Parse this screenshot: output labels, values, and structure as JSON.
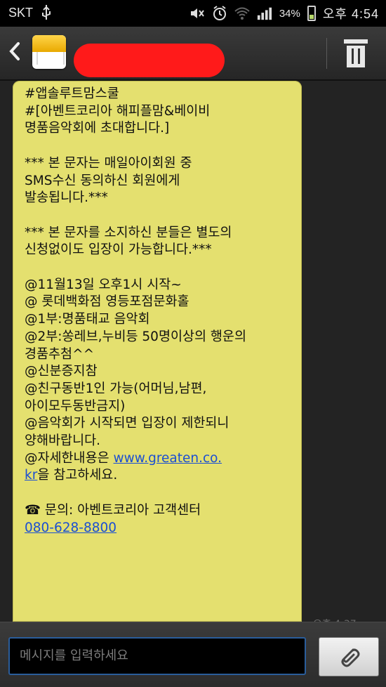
{
  "status_bar": {
    "carrier": "SKT",
    "battery": "34%",
    "time": "오후 4:54",
    "icons": [
      "usb-icon",
      "mute-icon",
      "alarm-icon",
      "wifi-icon",
      "signal-icon",
      "battery-icon"
    ]
  },
  "header": {
    "contact_redacted": true,
    "icons": [
      "back-arrow-icon",
      "envelope-icon",
      "trash-icon"
    ]
  },
  "message": {
    "body": "#앱솔루트맘스쿨\n#[아벤트코리아 해피플맘&베이비\n명품음악회에 초대합니다.]\n\n*** 본 문자는 매일아이회원 중\nSMS수신 동의하신 회원에게\n발송됩니다.***\n\n*** 본 문자를 소지하신 분들은 별도의\n신청없이도 입장이 가능합니다.***\n\n@11월13일 오후1시 시작~\n@ 롯데백화점 영등포점문화홀\n@1부:명품태교 음악회\n@2부:쏭레브,누비등 50명이상의 행운의\n경품추첨^^\n@신분증지참\n@친구동반1인 가능(어머님,남편,\n아이모두동반금지)\n@음악회가 시작되면 입장이 제한되니\n양해바랍니다.\n@자세한내용은 ",
    "link1": "www.greaten.co.\nkr",
    "after_link": "을 참고하세요.\n\n",
    "contact_line": "☎ 문의: 아벤트코리아 고객센터",
    "phone_link": "080-628-8800",
    "timestamp_partial": "오후 4:37"
  },
  "composer": {
    "placeholder": "메시지를 입력하세요",
    "icons": [
      "paperclip-icon"
    ]
  }
}
